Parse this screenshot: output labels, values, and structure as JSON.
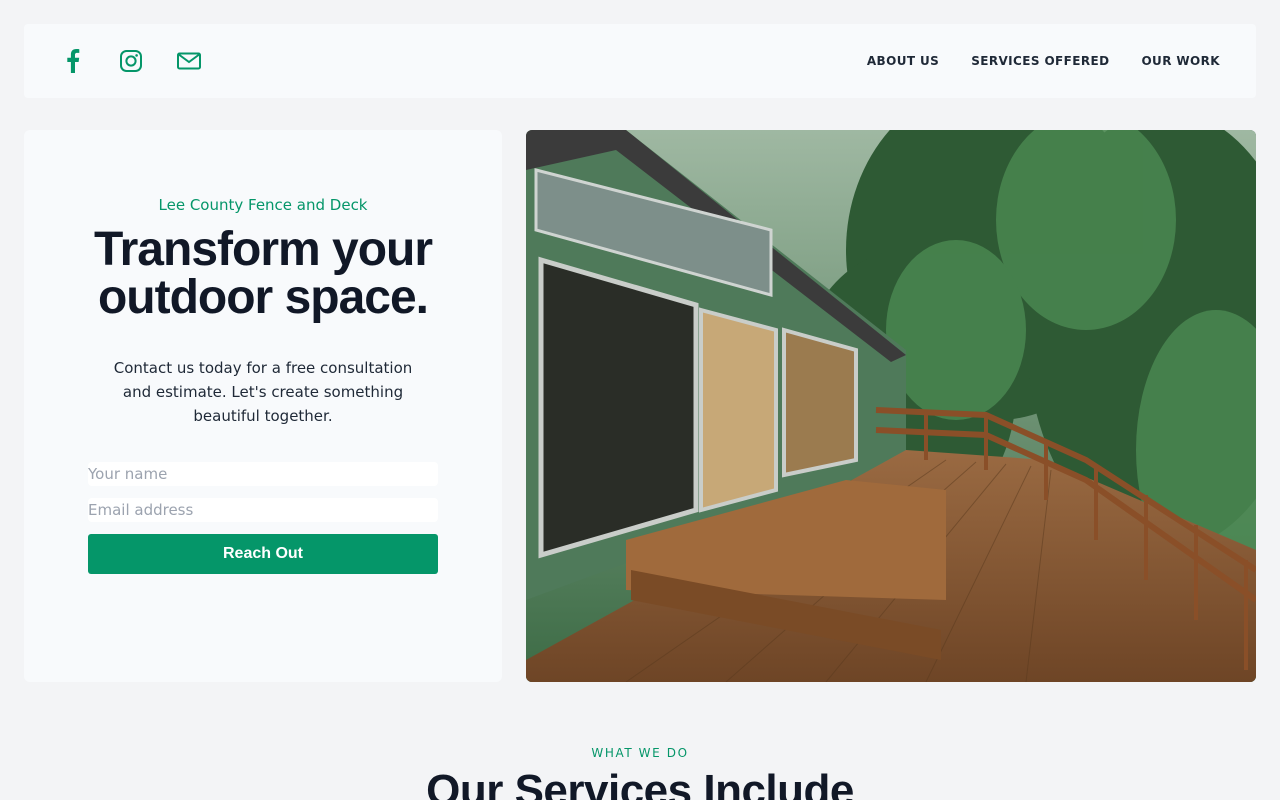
{
  "header": {
    "social": [
      {
        "name": "facebook-icon"
      },
      {
        "name": "instagram-icon"
      },
      {
        "name": "mail-icon"
      }
    ],
    "nav": [
      "ABOUT US",
      "SERVICES OFFERED",
      "OUR WORK"
    ]
  },
  "hero": {
    "eyebrow": "Lee County Fence and Deck",
    "headline": "Transform your outdoor space.",
    "lead": "Contact us today for a free consultation and estimate. Let's create something beautiful together.",
    "form": {
      "name_placeholder": "Your name",
      "name_value": "",
      "email_placeholder": "Email address",
      "email_value": "",
      "submit_label": "Reach Out"
    }
  },
  "services": {
    "eyebrow": "WHAT WE DO",
    "title": "Our Services Include"
  },
  "colors": {
    "accent": "#059669",
    "background": "#f3f4f6",
    "card": "#f8fafc",
    "text": "#111827"
  }
}
